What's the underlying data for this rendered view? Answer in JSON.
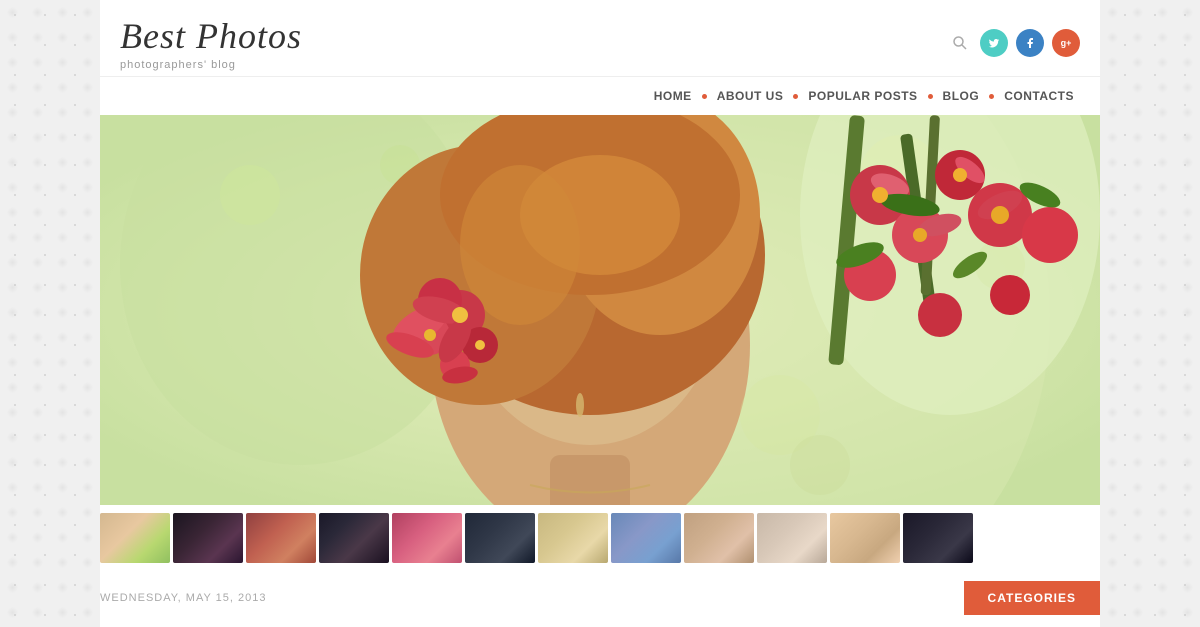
{
  "site": {
    "title": "Best Photos",
    "subtitle": "photographers' blog"
  },
  "header": {
    "search_placeholder": "Search...",
    "social": [
      {
        "name": "twitter",
        "label": "t",
        "color": "social-twitter"
      },
      {
        "name": "facebook",
        "label": "f",
        "color": "social-facebook"
      },
      {
        "name": "google",
        "label": "g+",
        "color": "social-google"
      }
    ]
  },
  "nav": {
    "items": [
      {
        "label": "HOME",
        "id": "home"
      },
      {
        "label": "ABOUT US",
        "id": "about"
      },
      {
        "label": "POPULAR POSTS",
        "id": "popular"
      },
      {
        "label": "BLOG",
        "id": "blog"
      },
      {
        "label": "CONTACTS",
        "id": "contacts"
      }
    ]
  },
  "hero": {
    "alt": "Woman with flowers in hair"
  },
  "thumbnails": [
    {
      "id": 1,
      "theme": "thumb-1"
    },
    {
      "id": 2,
      "theme": "thumb-2"
    },
    {
      "id": 3,
      "theme": "thumb-3"
    },
    {
      "id": 4,
      "theme": "thumb-4"
    },
    {
      "id": 5,
      "theme": "thumb-5"
    },
    {
      "id": 6,
      "theme": "thumb-6"
    },
    {
      "id": 7,
      "theme": "thumb-7"
    },
    {
      "id": 8,
      "theme": "thumb-8"
    },
    {
      "id": 9,
      "theme": "thumb-9"
    },
    {
      "id": 10,
      "theme": "thumb-10"
    },
    {
      "id": 11,
      "theme": "thumb-11"
    },
    {
      "id": 12,
      "theme": "thumb-12"
    }
  ],
  "bottom": {
    "date": "WEDNESDAY, MAY 15, 2013",
    "categories_label": "CATEGORIES"
  },
  "colors": {
    "accent": "#e05c3a",
    "twitter": "#4ecdc4",
    "facebook": "#3b82c4",
    "google": "#e05c3a"
  }
}
